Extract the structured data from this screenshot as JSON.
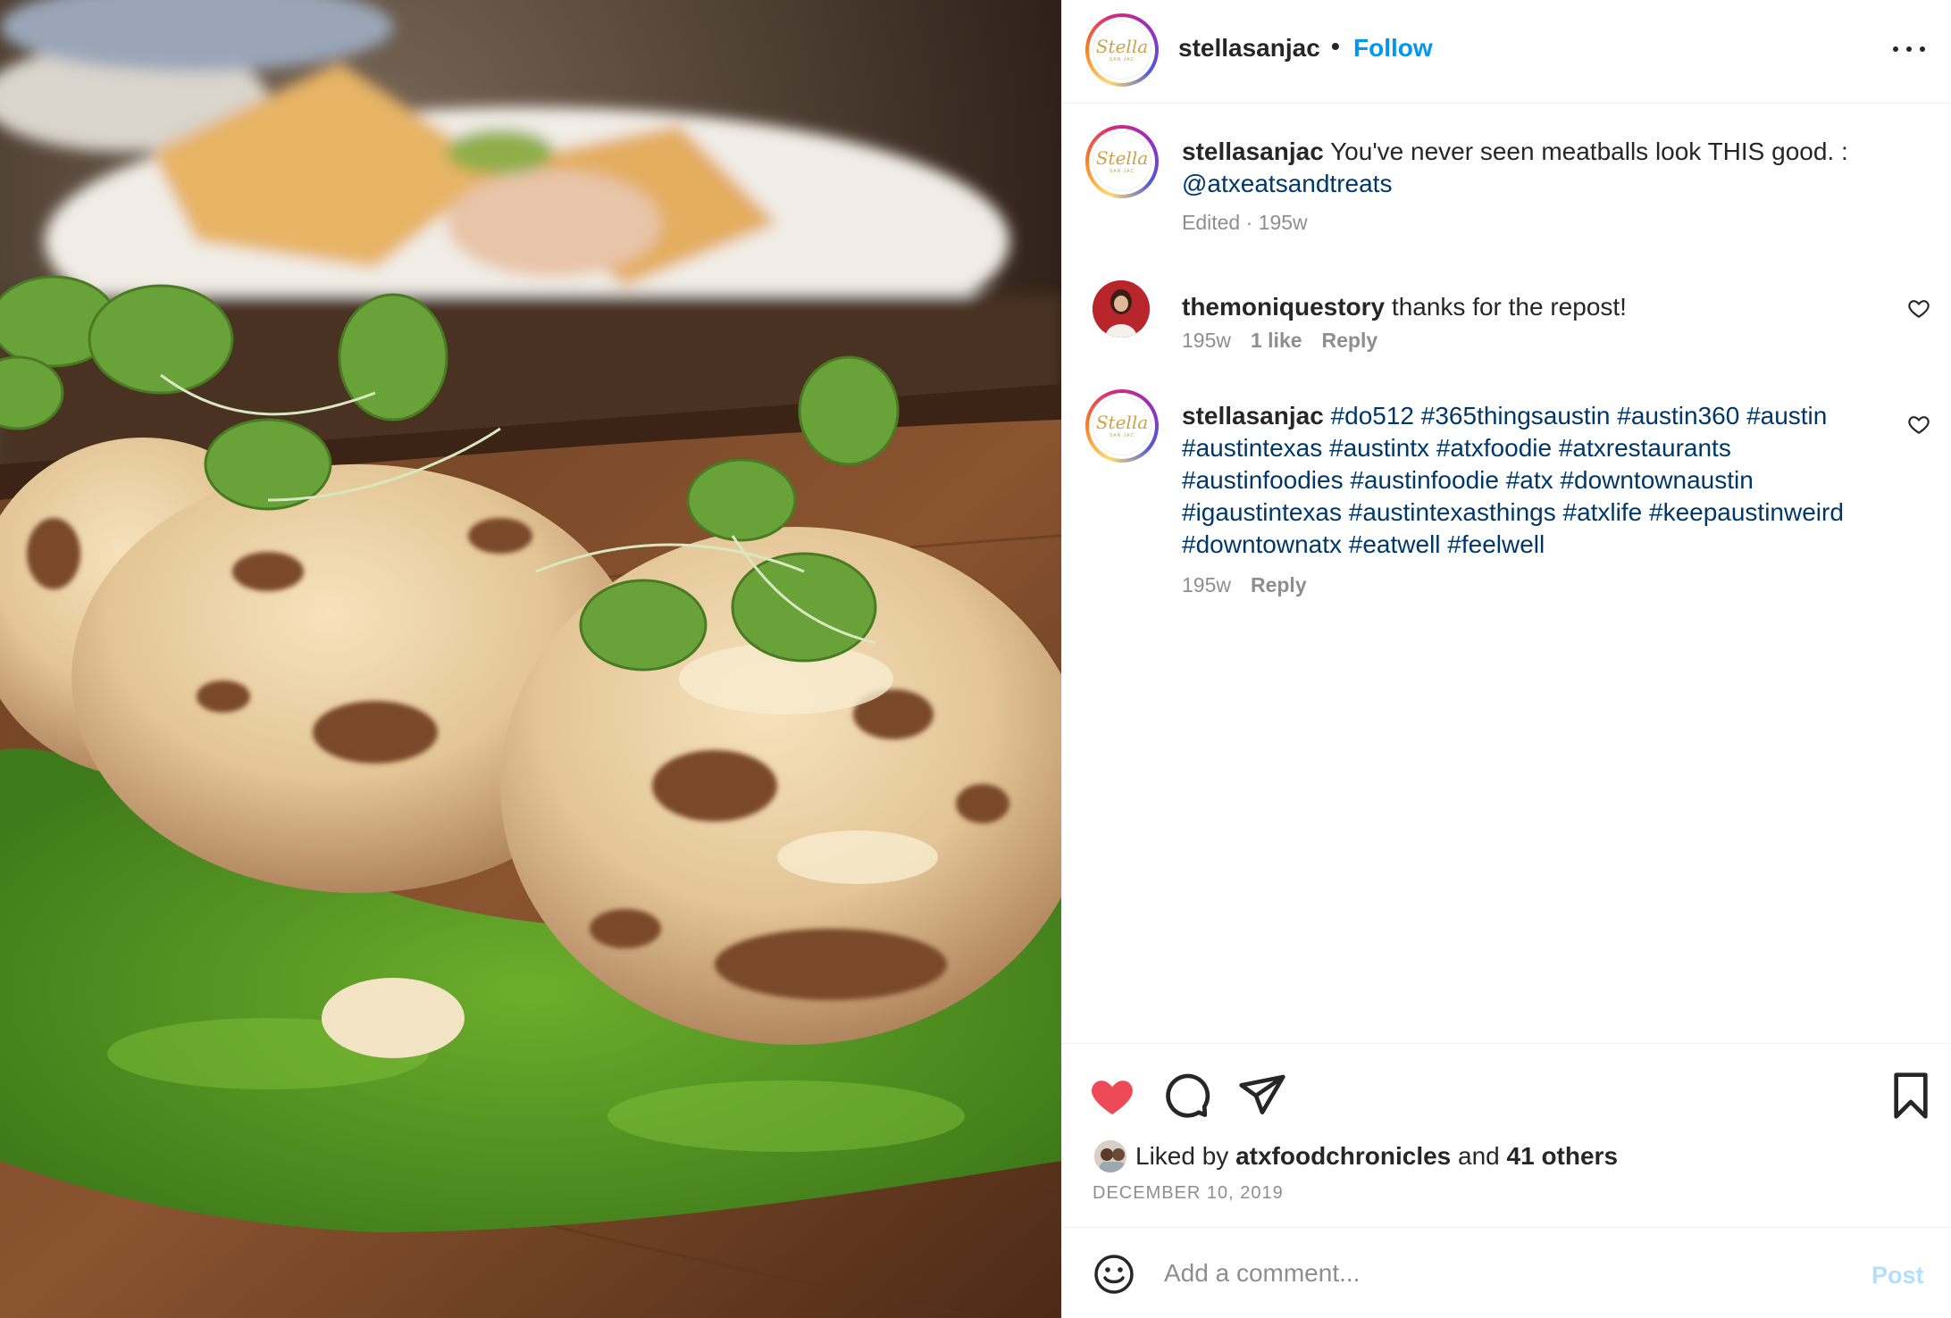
{
  "colors": {
    "accent": "#0095f6",
    "link": "#00376b",
    "muted": "#8e8e8e",
    "like_red": "#ed4956",
    "post_disabled": "#b2dffc"
  },
  "header": {
    "username": "stellasanjac",
    "separator": "•",
    "follow_label": "Follow",
    "more_icon": "more-horizontal-icon"
  },
  "logo": {
    "script": "Stella",
    "sub": "SAN JAC"
  },
  "caption": {
    "username": "stellasanjac",
    "text": "You've never seen meatballs look THIS good. :",
    "mention": "@atxeatsandtreats",
    "meta": "Edited · 195w"
  },
  "comments": [
    {
      "username": "themoniquestory",
      "text": "thanks for the repost!",
      "age": "195w",
      "likes": "1 like",
      "reply_label": "Reply"
    },
    {
      "username": "stellasanjac",
      "hashtags": "#do512 #365thingsaustin #austin360 #austin #austintexas #austintx #atxfoodie #atxrestaurants #austinfoodies #austinfoodie #atx #downtownaustin #igaustintexas #austintexasthings #atxlife #keepaustinweird #downtownatx #eatwell #feelwell",
      "age": "195w",
      "reply_label": "Reply"
    }
  ],
  "actions": {
    "like_icon": "heart-filled-icon",
    "comment_icon": "comment-icon",
    "share_icon": "send-icon",
    "save_icon": "bookmark-icon"
  },
  "likes": {
    "prefix": "Liked by",
    "user": "atxfoodchronicles",
    "middle": "and",
    "others": "41 others"
  },
  "post_date": "DECEMBER 10, 2019",
  "comment_box": {
    "placeholder": "Add a comment...",
    "post_label": "Post",
    "emoji_icon": "emoji-icon"
  }
}
